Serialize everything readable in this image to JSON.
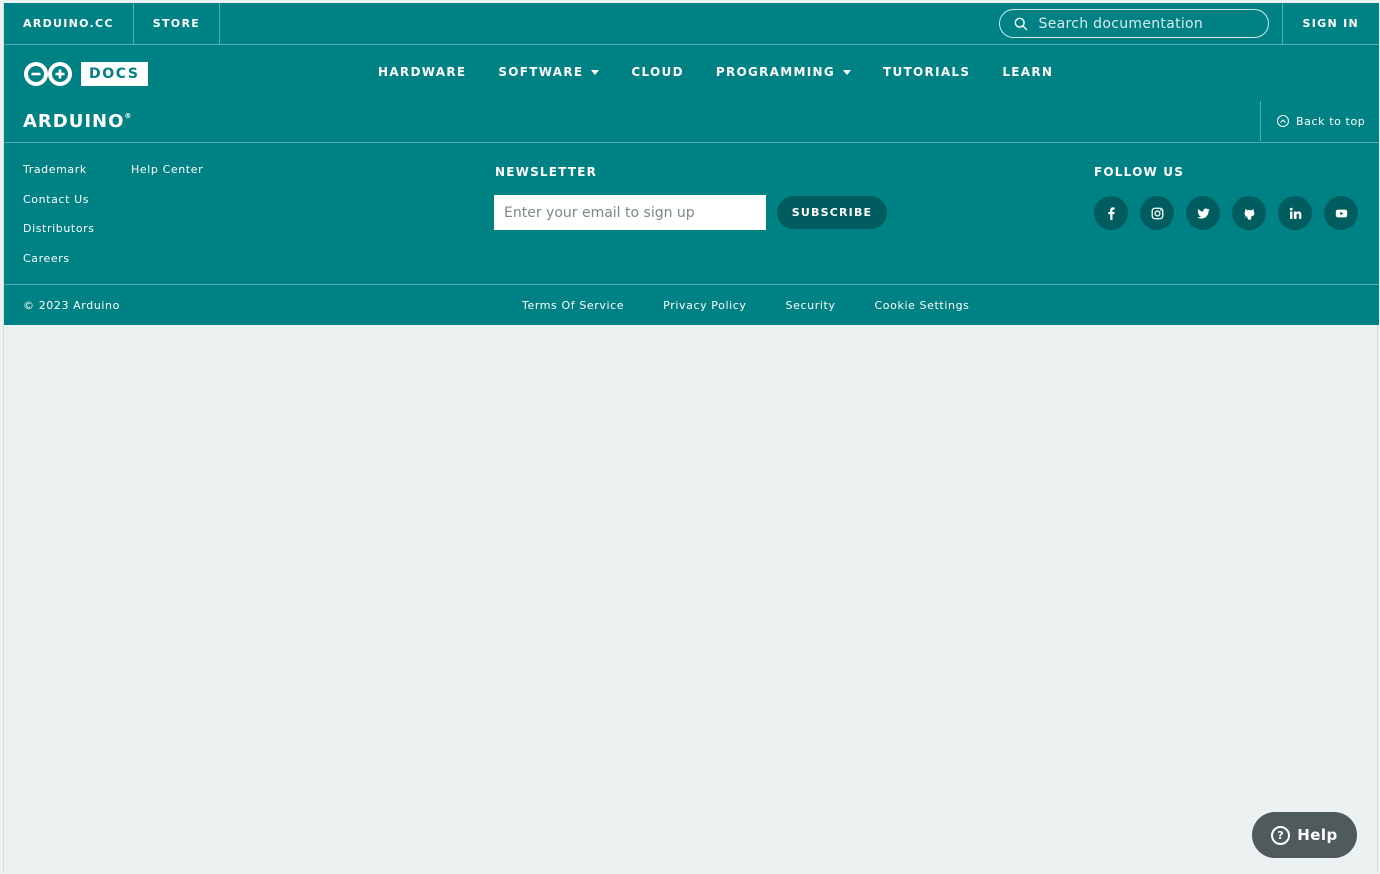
{
  "topbar": {
    "tabs": [
      "ARDUINO.CC",
      "STORE"
    ],
    "search_placeholder": "Search documentation",
    "sign_in": "SIGN IN"
  },
  "nav": {
    "docs_label": "DOCS",
    "items": [
      {
        "label": "HARDWARE",
        "dropdown": false
      },
      {
        "label": "SOFTWARE",
        "dropdown": true
      },
      {
        "label": "CLOUD",
        "dropdown": false
      },
      {
        "label": "PROGRAMMING",
        "dropdown": true
      },
      {
        "label": "TUTORIALS",
        "dropdown": false
      },
      {
        "label": "LEARN",
        "dropdown": false
      }
    ]
  },
  "brand": {
    "name": "ARDUINO",
    "reg": "®",
    "back_to_top": "Back to top"
  },
  "footer": {
    "links": [
      "Trademark",
      "Help Center",
      "Contact Us",
      "Distributors",
      "Careers"
    ],
    "newsletter_title": "NEWSLETTER",
    "email_placeholder": "Enter your email to sign up",
    "subscribe_label": "SUBSCRIBE",
    "follow_title": "FOLLOW US",
    "socials": [
      "facebook-icon",
      "instagram-icon",
      "twitter-icon",
      "github-icon",
      "linkedin-icon",
      "youtube-icon"
    ]
  },
  "bottom": {
    "copyright": "© 2023 Arduino",
    "legal": [
      "Terms Of Service",
      "Privacy Policy",
      "Security",
      "Cookie Settings"
    ]
  },
  "help": {
    "label": "Help"
  },
  "colors": {
    "primary": "#008184",
    "dark_teal": "#005c5f",
    "background": "#ecf1f1",
    "help_bg": "#4f5a5d"
  }
}
